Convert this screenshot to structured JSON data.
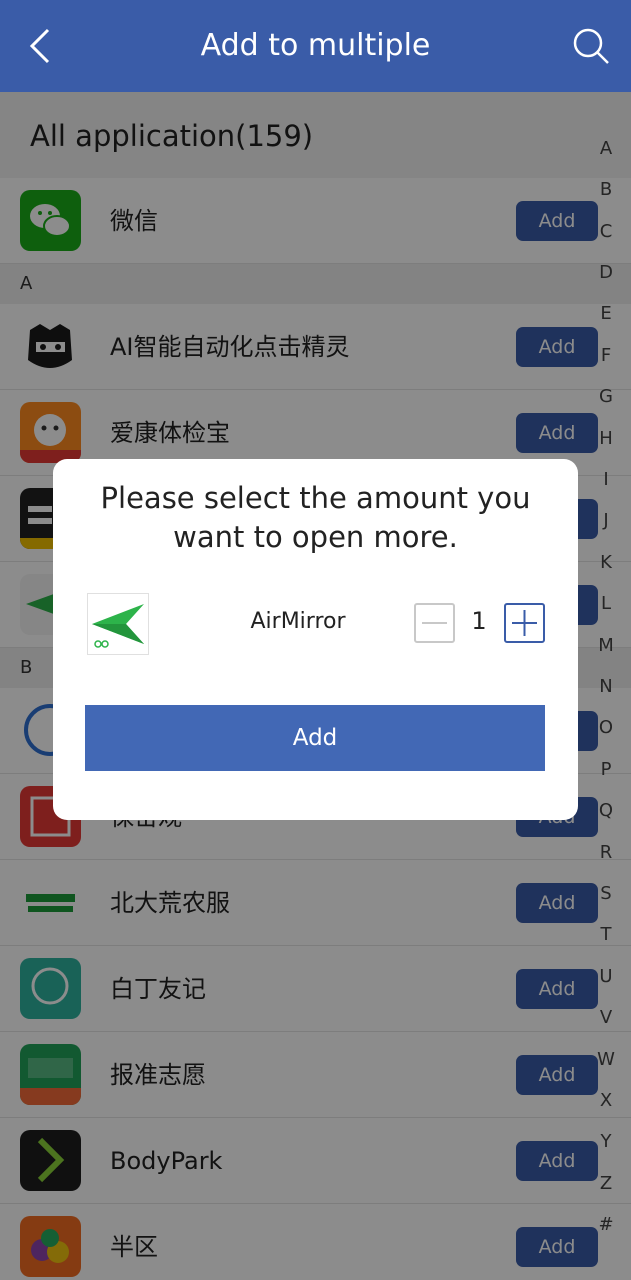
{
  "header": {
    "title": "Add to multiple",
    "back_icon": "chevron-left-icon",
    "search_icon": "search-icon"
  },
  "list": {
    "all_label": "All application(159)",
    "add_label": "Add",
    "pinned": [
      {
        "name": "微信",
        "icon": "wechat-icon"
      }
    ],
    "sections": [
      {
        "letter": "A",
        "items": [
          {
            "name": "AI智能自动化点击精灵",
            "icon": "robot-face-icon"
          },
          {
            "name": "爱康体检宝",
            "icon": "cat-mascot-icon"
          },
          {
            "name": "",
            "icon": "app-icon"
          },
          {
            "name": "",
            "icon": "airmirror-icon"
          }
        ]
      },
      {
        "letter": "B",
        "items": [
          {
            "name": "",
            "icon": "shield-app-icon"
          },
          {
            "name": "保密观",
            "icon": "seal-icon"
          },
          {
            "name": "北大荒农服",
            "icon": "smart-logo-icon"
          },
          {
            "name": "白丁友记",
            "icon": "friend-logo-icon"
          },
          {
            "name": "报准志愿",
            "icon": "gaobao-icon"
          },
          {
            "name": "BodyPark",
            "icon": "bodypark-icon"
          },
          {
            "name": "半区",
            "icon": "fruit-icon"
          }
        ]
      }
    ]
  },
  "index_letters": [
    "A",
    "B",
    "C",
    "D",
    "E",
    "F",
    "G",
    "H",
    "I",
    "J",
    "K",
    "L",
    "M",
    "N",
    "O",
    "P",
    "Q",
    "R",
    "S",
    "T",
    "U",
    "V",
    "W",
    "X",
    "Y",
    "Z",
    "#"
  ],
  "dialog": {
    "prompt": "Please select the amount you want to open more.",
    "app_name": "AirMirror",
    "app_icon": "airmirror-icon",
    "quantity": "1",
    "minus_icon": "minus-icon",
    "plus_icon": "plus-icon",
    "confirm_label": "Add"
  },
  "colors": {
    "primary": "#3a5ca8",
    "dialog_button": "#4268b5",
    "overlay": "rgba(0,0,0,0.45)"
  }
}
